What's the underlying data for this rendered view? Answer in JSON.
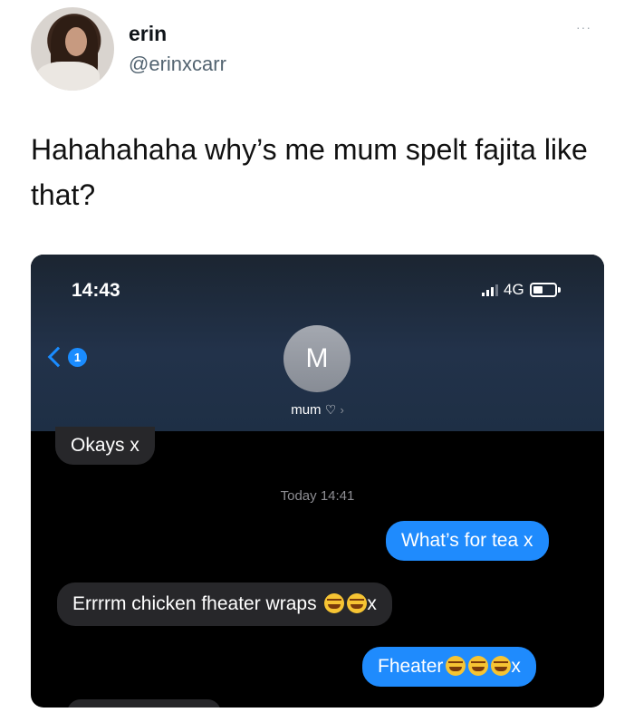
{
  "tweet": {
    "name": "erin",
    "handle": "@erinxcarr",
    "more_label": "···",
    "text": "Hahahahaha why’s me mum spelt fajita like that?"
  },
  "phone": {
    "status_time": "14:43",
    "network": "4G",
    "back_badge": "1",
    "contact_initial": "M",
    "contact_name": "mum",
    "contact_heart": "♡",
    "contact_arrow": "›",
    "messages": [
      {
        "side": "in",
        "text": "Okays x"
      },
      {
        "side": "out",
        "text": "What’s for tea x"
      },
      {
        "side": "in",
        "text": "Errrrm chicken fheater wraps",
        "suffix": "x",
        "emojis": [
          "rofl-emoji",
          "rofl-emoji"
        ]
      },
      {
        "side": "out",
        "text": "Fheater",
        "suffix": "x",
        "emojis": [
          "laughing-emoji",
          "laughing-emoji",
          "laughing-emoji"
        ]
      }
    ],
    "timestamp": "Today 14:41"
  }
}
